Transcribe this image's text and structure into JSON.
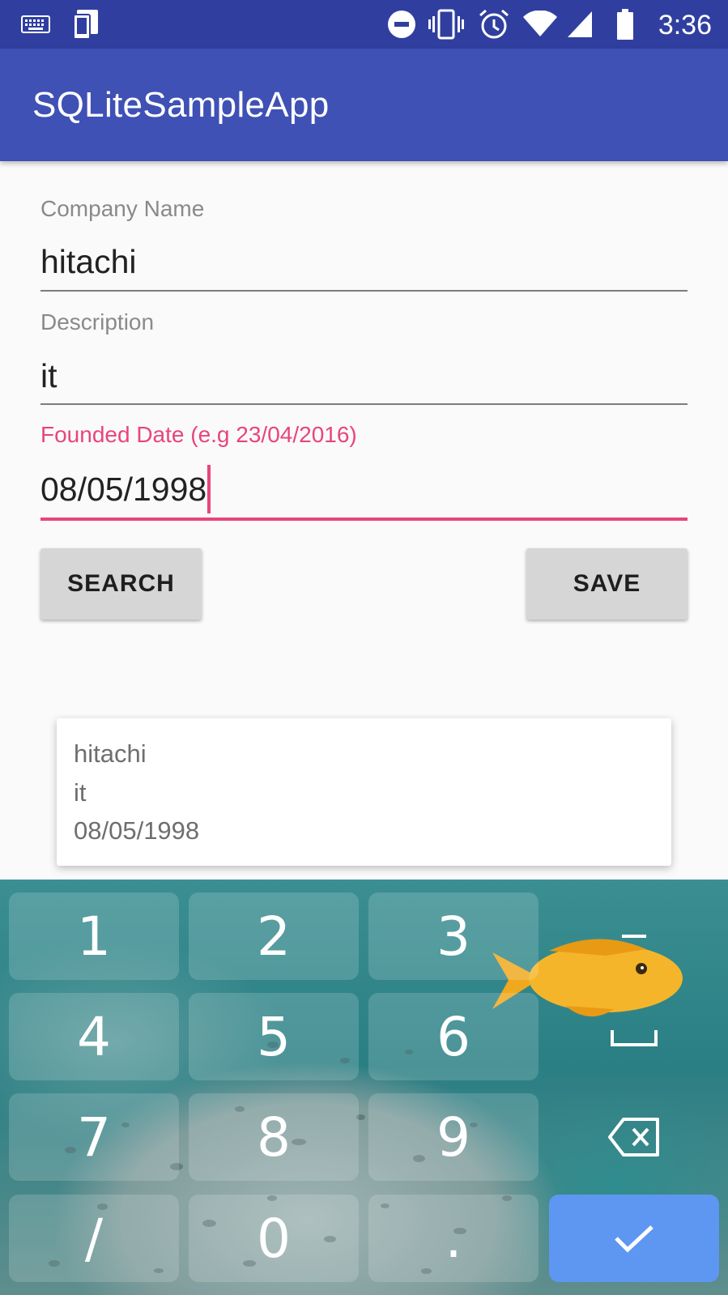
{
  "status_bar": {
    "time": "3:36",
    "left_icons": [
      "keyboard-icon",
      "device-icon"
    ],
    "right_icons": [
      "do-not-disturb-icon",
      "vibrate-icon",
      "alarm-icon",
      "wifi-icon",
      "signal-icon",
      "battery-icon"
    ]
  },
  "app_bar": {
    "title": "SQLiteSampleApp"
  },
  "form": {
    "company": {
      "label": "Company Name",
      "value": "hitachi"
    },
    "description": {
      "label": "Description",
      "value": "it"
    },
    "founded": {
      "label": "Founded Date (e.g 23/04/2016)",
      "value": "08/05/1998"
    },
    "search_label": "SEARCH",
    "save_label": "SAVE"
  },
  "result": {
    "lines": [
      "hitachi",
      "it",
      "08/05/1998"
    ]
  },
  "keyboard": {
    "keys": [
      "1",
      "2",
      "3",
      "4",
      "5",
      "6",
      "7",
      "8",
      "9",
      "/",
      "0",
      "."
    ],
    "function_keys": [
      "minus-key",
      "space-key",
      "backspace-key",
      "enter-key"
    ],
    "enter_color": "#5e97f2"
  },
  "colors": {
    "status_bar": "#303f9f",
    "app_bar": "#3f51b5",
    "accent": "#e8457c"
  }
}
